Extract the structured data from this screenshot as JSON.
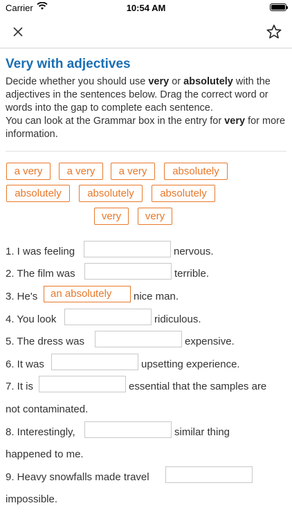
{
  "status_bar": {
    "carrier": "Carrier",
    "time": "10:54 AM"
  },
  "nav": {
    "close_icon": "close-icon",
    "favorite_icon": "star-icon"
  },
  "title": "Very with adjectives",
  "intro": {
    "p1_a": "Decide whether you should use ",
    "p1_very": "very",
    "p1_b": " or ",
    "p1_absolutely": "absolutely",
    "p1_c": " with the adjectives in the sentences below. Drag the correct word or words into the gap to complete each sentence.",
    "p2_a": "You can look at the Grammar box in the entry for ",
    "p2_very": "very",
    "p2_b": " for more information."
  },
  "word_bank": [
    "a very",
    "a very",
    "a very",
    "absolutely",
    "absolutely",
    "absolutely",
    "absolutely",
    "very",
    "very"
  ],
  "questions": [
    {
      "before": "1. I was feeling",
      "after": "nervous.",
      "answer": ""
    },
    {
      "before": "2. The film was",
      "after": "terrible.",
      "answer": ""
    },
    {
      "before": "3. He's",
      "after": "nice man.",
      "answer": "an absolutely"
    },
    {
      "before": "4. You look",
      "after": "ridiculous.",
      "answer": ""
    },
    {
      "before": "5. The dress was",
      "after": "expensive.",
      "answer": ""
    },
    {
      "before": "6. It was",
      "after": "upsetting experience.",
      "answer": ""
    },
    {
      "before": "7. It is",
      "after": "essential that the samples are",
      "after2": "not contaminated.",
      "answer": ""
    },
    {
      "before": "8. Interestingly,",
      "after": "similar thing",
      "after2": "happened to me.",
      "answer": ""
    },
    {
      "before": "9. Heavy snowfalls made travel",
      "after": "",
      "after2": "impossible.",
      "answer": ""
    }
  ],
  "colors": {
    "title": "#1a6eb3",
    "chip": "#e8782a"
  }
}
